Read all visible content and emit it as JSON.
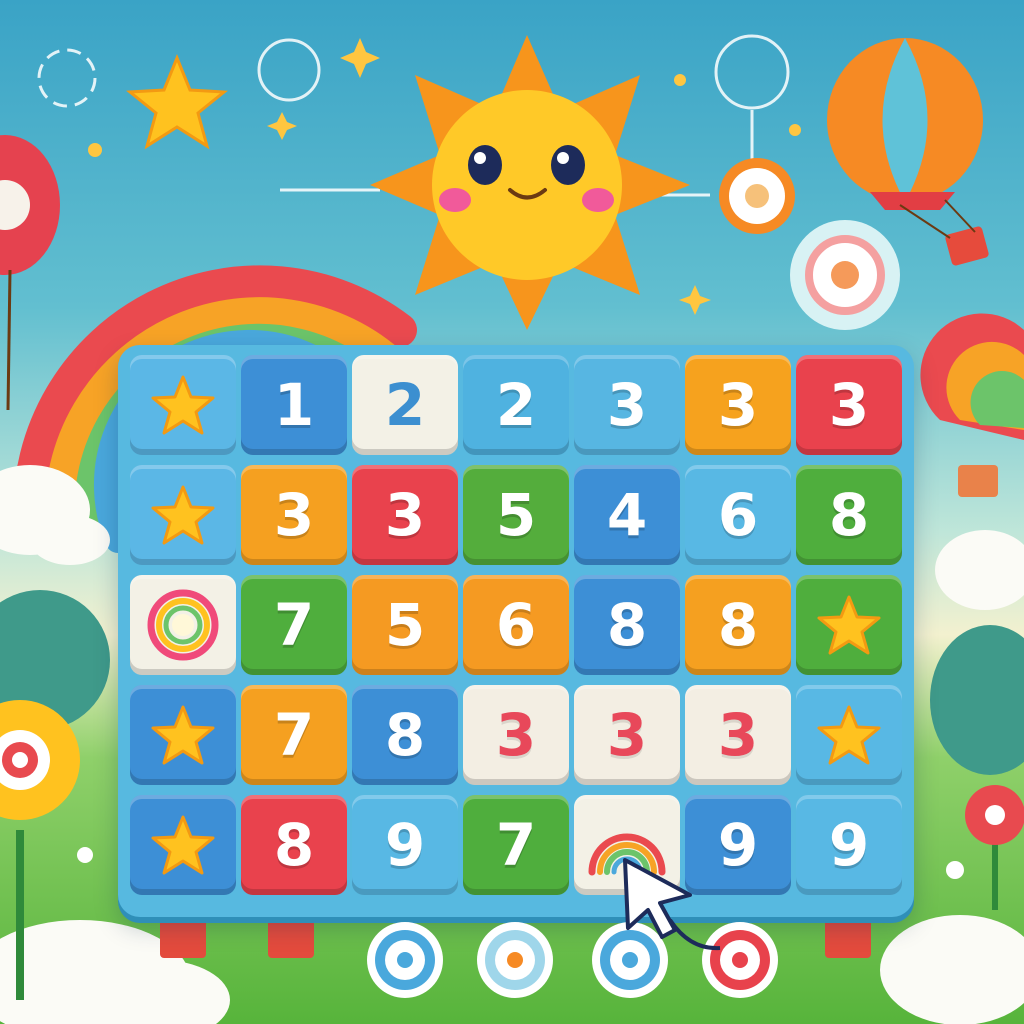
{
  "board": {
    "rows": [
      [
        {
          "kind": "star",
          "color": "#5bb7e6"
        },
        {
          "kind": "num",
          "value": "1",
          "color": "#3d8fd6"
        },
        {
          "kind": "num",
          "value": "2",
          "color": "#f3f1e6",
          "style": "blue"
        },
        {
          "kind": "num",
          "value": "2",
          "color": "#4fb2e0"
        },
        {
          "kind": "num",
          "value": "3",
          "color": "#57b6e2"
        },
        {
          "kind": "num",
          "value": "3",
          "color": "#f6a21e"
        },
        {
          "kind": "num",
          "value": "3",
          "color": "#e9424d"
        }
      ],
      [
        {
          "kind": "star",
          "color": "#5bb7e6"
        },
        {
          "kind": "num",
          "value": "3",
          "color": "#f5a020"
        },
        {
          "kind": "num",
          "value": "3",
          "color": "#e9424d"
        },
        {
          "kind": "num",
          "value": "5",
          "color": "#54ad3c"
        },
        {
          "kind": "num",
          "value": "4",
          "color": "#3d8fd6"
        },
        {
          "kind": "num",
          "value": "6",
          "color": "#58b8e4"
        },
        {
          "kind": "num",
          "value": "8",
          "color": "#4fae3d"
        }
      ],
      [
        {
          "kind": "ring",
          "color": "#f3f1e6"
        },
        {
          "kind": "num",
          "value": "7",
          "color": "#4fae3d"
        },
        {
          "kind": "num",
          "value": "5",
          "color": "#f59a22"
        },
        {
          "kind": "num",
          "value": "6",
          "color": "#f59a22"
        },
        {
          "kind": "num",
          "value": "8",
          "color": "#3d8fd6"
        },
        {
          "kind": "num",
          "value": "8",
          "color": "#f5a020"
        },
        {
          "kind": "star",
          "color": "#4fae3d"
        }
      ],
      [
        {
          "kind": "star",
          "color": "#3d8fd6"
        },
        {
          "kind": "num",
          "value": "7",
          "color": "#f5a020"
        },
        {
          "kind": "num",
          "value": "8",
          "color": "#3d8fd6"
        },
        {
          "kind": "num",
          "value": "3",
          "color": "#f3eee3",
          "style": "dark"
        },
        {
          "kind": "num",
          "value": "3",
          "color": "#f3eee3",
          "style": "dark"
        },
        {
          "kind": "num",
          "value": "3",
          "color": "#f3eee3",
          "style": "dark"
        },
        {
          "kind": "star",
          "color": "#58b8e4"
        }
      ],
      [
        {
          "kind": "star",
          "color": "#3d8fd6"
        },
        {
          "kind": "num",
          "value": "8",
          "color": "#e9424d"
        },
        {
          "kind": "num",
          "value": "9",
          "color": "#58b8e4"
        },
        {
          "kind": "num",
          "value": "7",
          "color": "#4fae3d"
        },
        {
          "kind": "rainbow",
          "color": "#f3f1e6"
        },
        {
          "kind": "num",
          "value": "9",
          "color": "#3d8fd6"
        },
        {
          "kind": "num",
          "value": "9",
          "color": "#58b8e4"
        }
      ]
    ]
  },
  "colors": {
    "sun": "#ffc928",
    "sun_rays": "#f7951c",
    "rainbow_red": "#ea4a4f"
  },
  "icons": [
    "sun-mascot-icon",
    "star-icon",
    "hot-air-balloon-icon",
    "rainbow-icon",
    "target-icon",
    "cursor-arrow-icon",
    "flower-icon",
    "cloud-icon"
  ]
}
